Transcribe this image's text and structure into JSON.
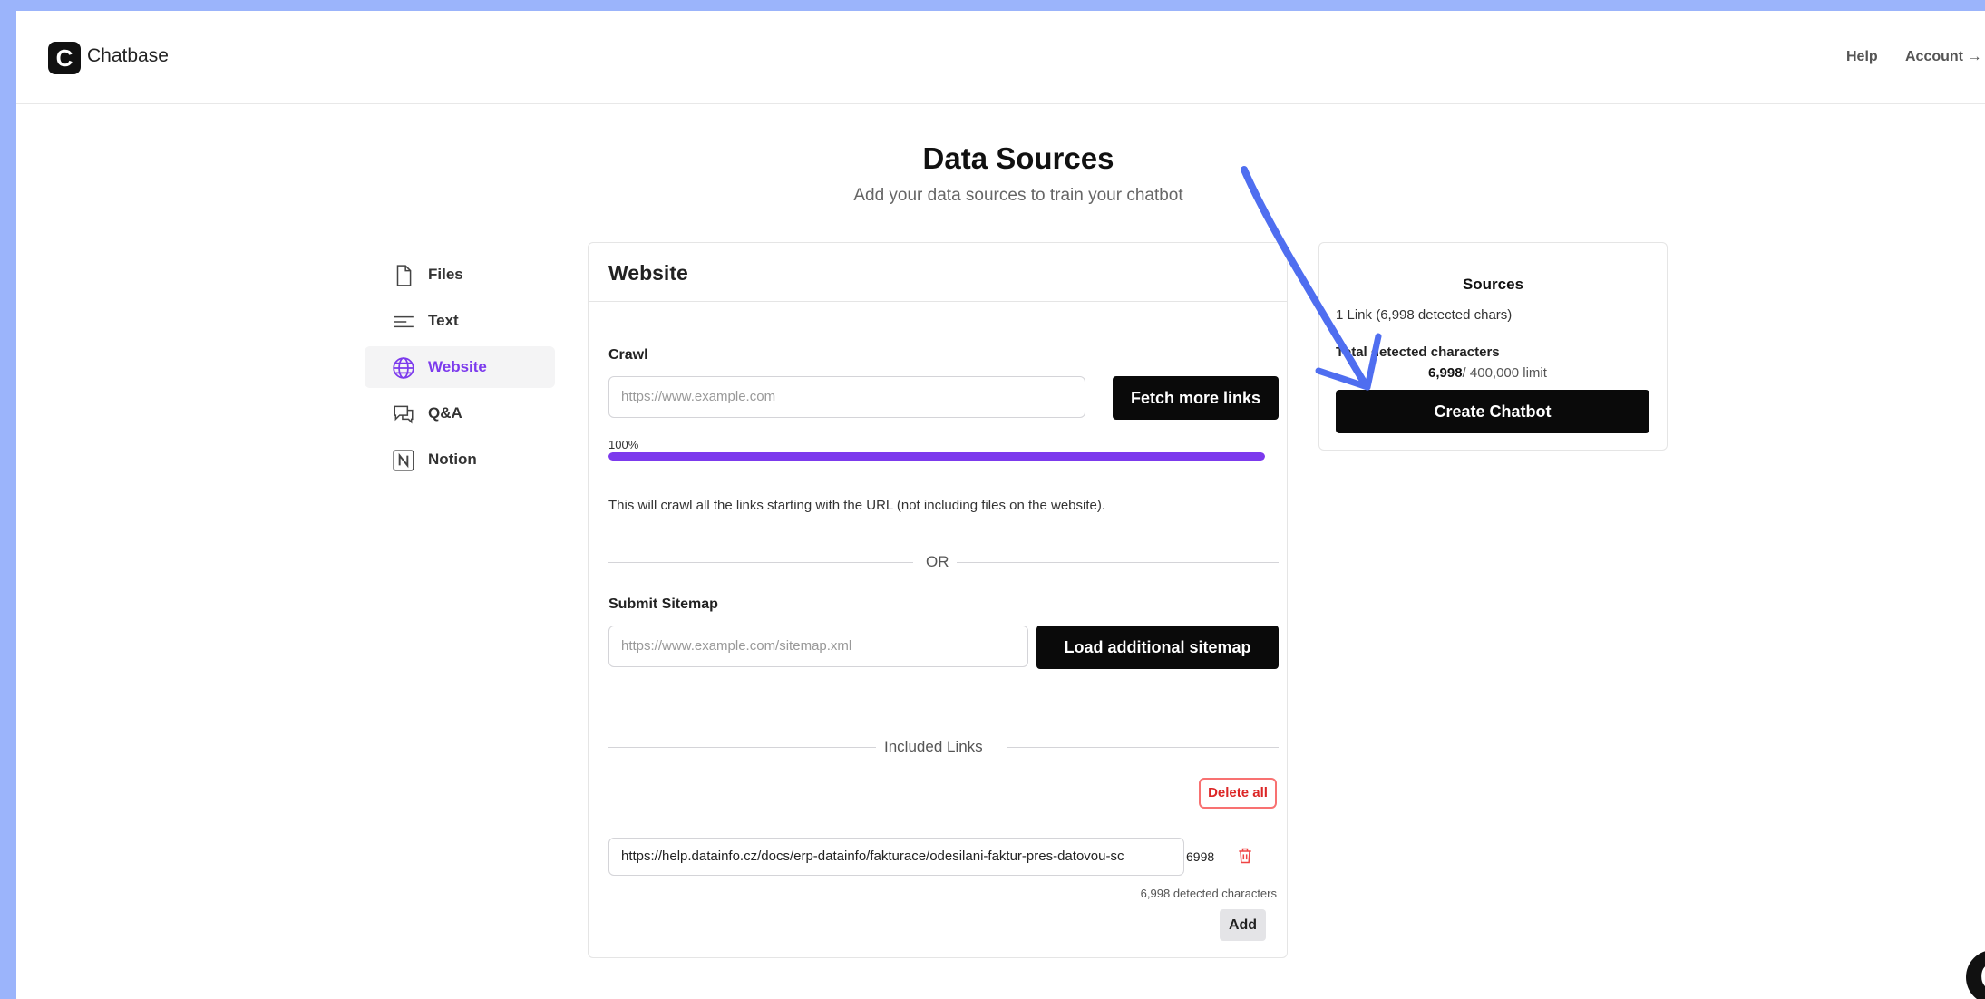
{
  "brand": {
    "name": "Chatbase",
    "logo_letter": "C"
  },
  "header": {
    "help": "Help",
    "account": "Account →"
  },
  "page": {
    "title": "Data Sources",
    "subtitle": "Add your data sources to train your chatbot"
  },
  "sidebar": {
    "items": [
      {
        "label": "Files",
        "icon": "file-icon",
        "active": false
      },
      {
        "label": "Text",
        "icon": "text-lines-icon",
        "active": false
      },
      {
        "label": "Website",
        "icon": "globe-icon",
        "active": true
      },
      {
        "label": "Q&A",
        "icon": "chat-bubbles-icon",
        "active": false
      },
      {
        "label": "Notion",
        "icon": "notion-icon",
        "active": false
      }
    ]
  },
  "website": {
    "title": "Website",
    "crawl_label": "Crawl",
    "crawl_placeholder": "https://www.example.com",
    "fetch_button": "Fetch more links",
    "progress_label": "100%",
    "progress_value": 1.0,
    "crawl_note": "This will crawl all the links starting with the URL (not including files on the website).",
    "or_text": "OR",
    "sitemap_label": "Submit Sitemap",
    "sitemap_placeholder": "https://www.example.com/sitemap.xml",
    "sitemap_button": "Load additional sitemap",
    "included_links_label": "Included Links",
    "delete_all_button": "Delete all",
    "links": [
      {
        "url": "https://help.datainfo.cz/docs/erp-datainfo/fakturace/odesilani-faktur-pres-datovou-sc",
        "chars": "6998"
      }
    ],
    "detected_characters": "6,998 detected characters",
    "add_button": "Add"
  },
  "sources": {
    "title": "Sources",
    "links_summary": "1 Link (6,998 detected chars)",
    "total_label": "Total detected characters",
    "total_count": "6,998",
    "total_limit": "/ 400,000 limit",
    "create_button": "Create Chatbot"
  },
  "colors": {
    "accent": "#7c3aed",
    "annotation_arrow": "#4f6ef0",
    "danger": "#dc2626",
    "background_frame": "#9bb4fb"
  },
  "chat_widget": {
    "letter": "C"
  }
}
